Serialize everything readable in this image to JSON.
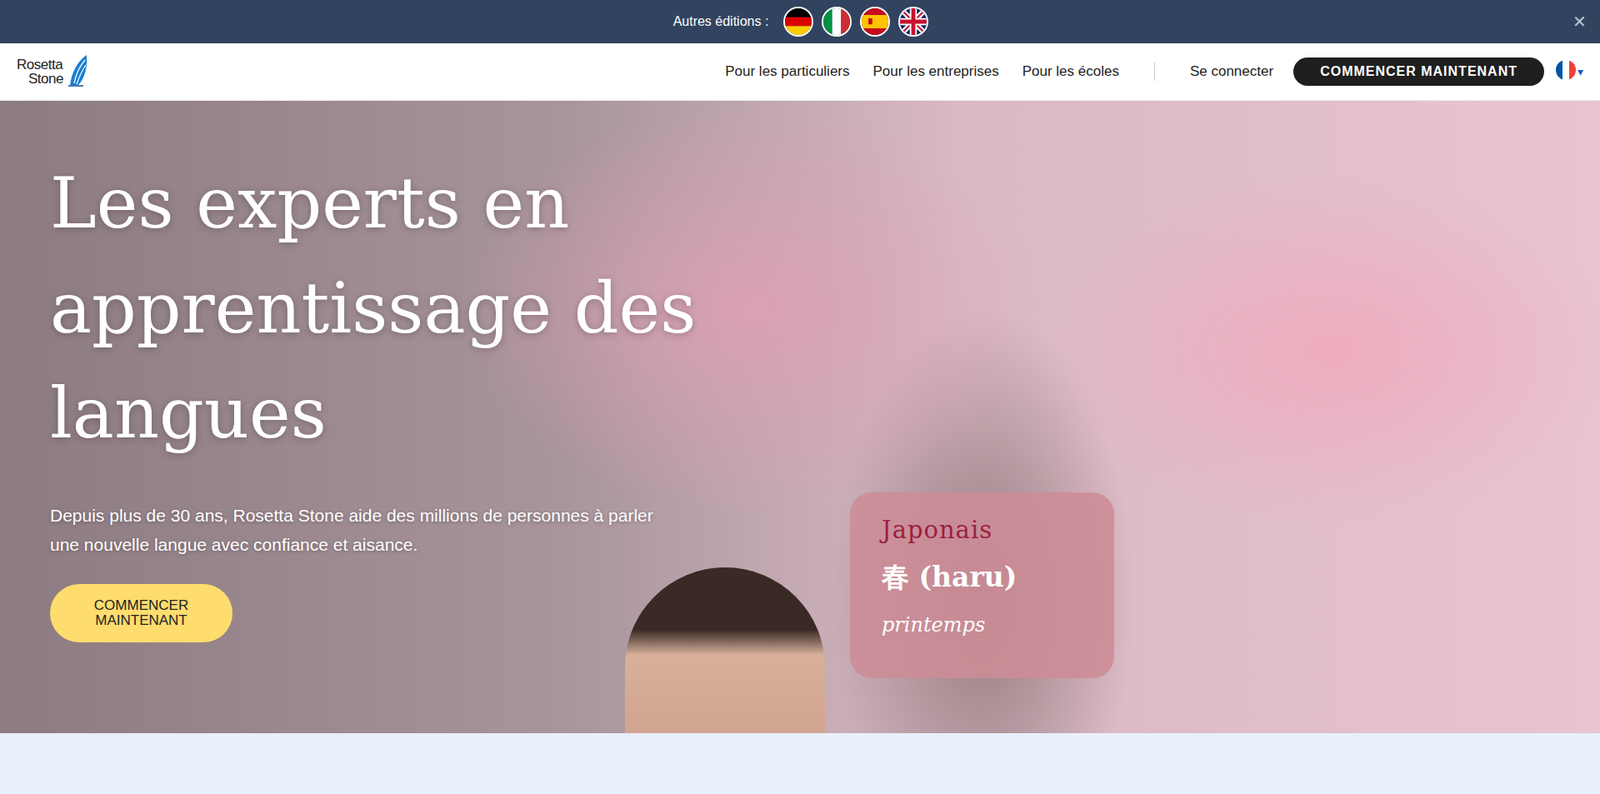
{
  "banner": {
    "label": "Autres éditions :",
    "close": "✕"
  },
  "logo": {
    "line1": "Rosetta",
    "line2": "Stone"
  },
  "nav": {
    "links": [
      "Pour les particuliers",
      "Pour les entreprises",
      "Pour les écoles"
    ],
    "sign_in": "Se connecter",
    "cta": "COMMENCER MAINTENANT",
    "language_arrow": "▾"
  },
  "hero": {
    "title_lines": [
      "Les experts en",
      "apprentissage des",
      "langues"
    ],
    "subtitle": "Depuis plus de 30 ans, Rosetta Stone aide des millions de personnes à parler une nouvelle langue avec confiance et aisance.",
    "cta_lines": [
      "COMMENCER",
      "MAINTENANT"
    ]
  },
  "word_card": {
    "language": "Japonais",
    "word": "春 (haru)",
    "translation": "printemps"
  }
}
